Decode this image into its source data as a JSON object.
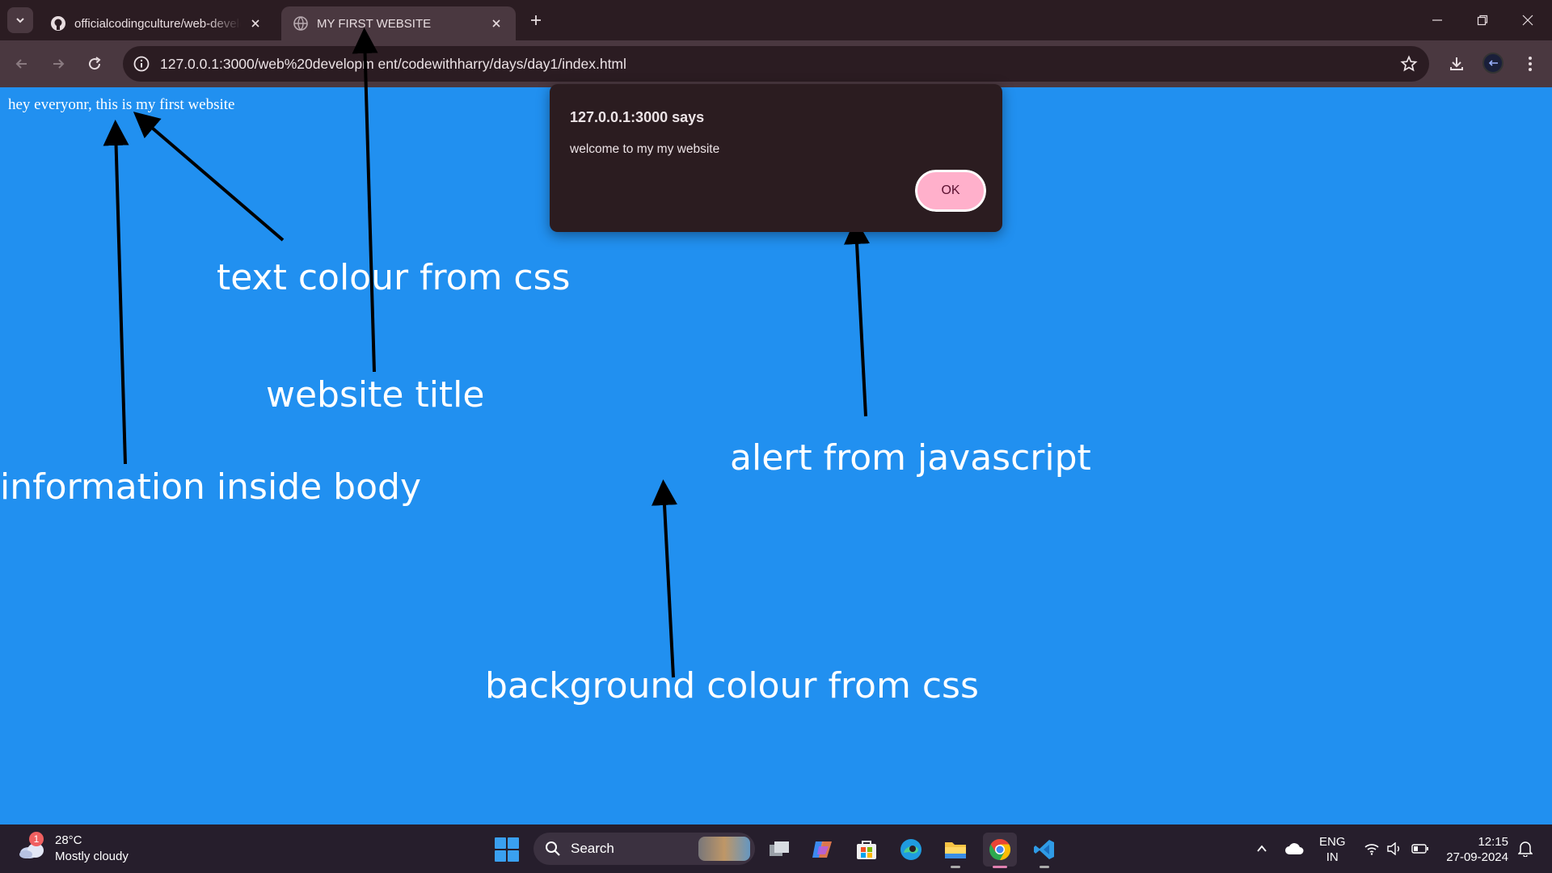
{
  "browser": {
    "tabs": [
      {
        "title": "officialcodingculture/web-development"
      },
      {
        "title": "MY FIRST WEBSITE"
      }
    ],
    "url": "127.0.0.1:3000/web%20developm ent/codewithharry/days/day1/index.html"
  },
  "page": {
    "body_text": "hey everyonr, this is my first website",
    "background_color": "#2190f0"
  },
  "alert": {
    "heading": "127.0.0.1:3000 says",
    "message": "welcome to my my website",
    "ok_label": "OK"
  },
  "annotations": [
    {
      "text": "text colour from css"
    },
    {
      "text": "website title"
    },
    {
      "text": "information inside body"
    },
    {
      "text": "alert from javascript"
    },
    {
      "text": "background colour from css"
    }
  ],
  "taskbar": {
    "weather": {
      "badge": "1",
      "temp": "28°C",
      "condition": "Mostly cloudy"
    },
    "search_label": "Search",
    "apps": [
      "file-explorer-icon",
      "copilot-icon",
      "microsoft-store-icon",
      "edge-icon",
      "folder-icon",
      "chrome-icon",
      "vscode-icon"
    ],
    "lang": {
      "line1": "ENG",
      "line2": "IN"
    },
    "time": "12:15",
    "date": "27-09-2024"
  }
}
